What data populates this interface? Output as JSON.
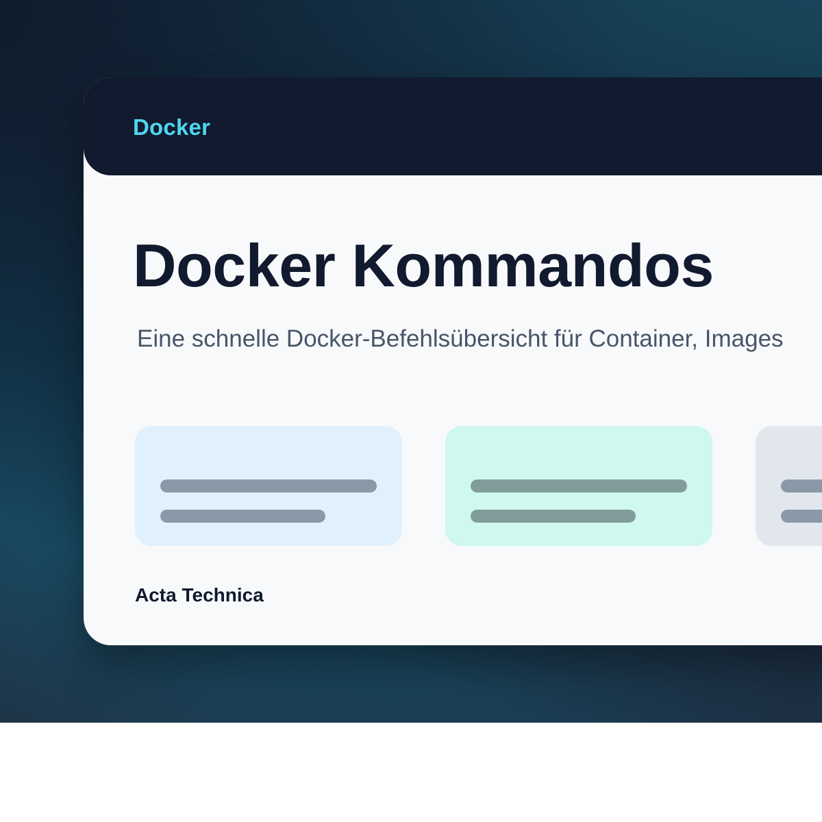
{
  "header": {
    "brand": "Docker"
  },
  "main": {
    "title": "Docker Kommandos",
    "subtitle": "Eine schnelle Docker-Befehlsübersicht für Container, Images"
  },
  "tiles": [
    {
      "name": "tile-blue",
      "color": "#e0f1fd"
    },
    {
      "name": "tile-green",
      "color": "#cff8ee"
    },
    {
      "name": "tile-gray",
      "color": "#e2e7ee"
    }
  ],
  "footer": {
    "brand": "Acta Technica"
  },
  "colors": {
    "brand_accent": "#4fd6f0",
    "header_bg": "#111a2e",
    "text_dark": "#111a2e",
    "text_muted": "#475569"
  }
}
